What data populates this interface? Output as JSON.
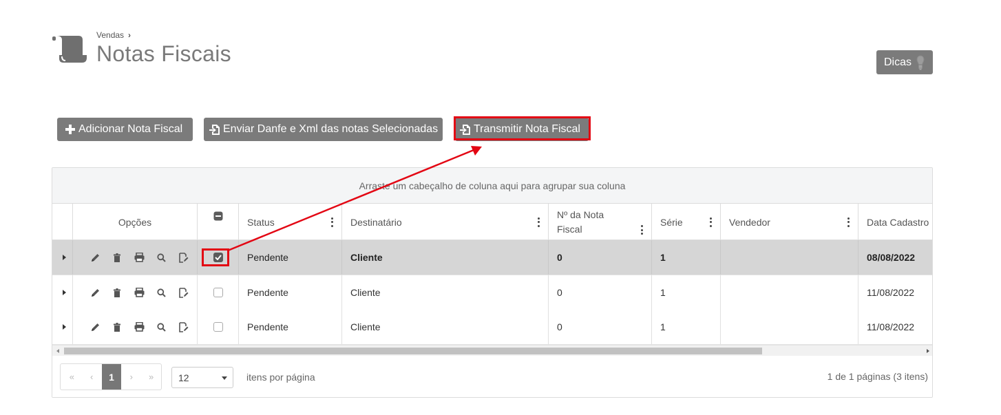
{
  "header": {
    "breadcrumb": "Vendas",
    "breadcrumb_sep": "›",
    "title": "Notas Fiscais",
    "tips_label": "Dicas"
  },
  "toolbar": {
    "add_label": "Adicionar Nota Fiscal",
    "send_label": "Enviar Danfe e Xml das notas Selecionadas",
    "transmit_label": "Transmitir Nota Fiscal"
  },
  "grid": {
    "group_hint": "Arraste um cabeçalho de coluna aqui para agrupar sua coluna",
    "columns": {
      "options": "Opções",
      "status": "Status",
      "recipient": "Destinatário",
      "invoice_number_line1": "Nº da Nota",
      "invoice_number_line2": "Fiscal",
      "series": "Série",
      "seller": "Vendedor",
      "created": "Data Cadastro"
    },
    "rows": [
      {
        "status": "Pendente",
        "recipient": "Cliente",
        "number": "0",
        "series": "1",
        "seller": "",
        "created": "08/08/2022",
        "selected": true
      },
      {
        "status": "Pendente",
        "recipient": "Cliente",
        "number": "0",
        "series": "1",
        "seller": "",
        "created": "11/08/2022",
        "selected": false
      },
      {
        "status": "Pendente",
        "recipient": "Cliente",
        "number": "0",
        "series": "1",
        "seller": "",
        "created": "11/08/2022",
        "selected": false
      }
    ]
  },
  "pagination": {
    "first": "«",
    "prev": "‹",
    "current_page": "1",
    "next": "›",
    "last": "»",
    "page_size": "12",
    "per_page_label": "itens por página",
    "info": "1 de 1 páginas (3 itens)"
  },
  "colors": {
    "button_bg": "#7b7b7b",
    "highlight": "#e30613",
    "selected_row": "#d6d6d6"
  },
  "icons": [
    "scroll-icon",
    "lightbulb-icon",
    "plus-icon",
    "file-export-icon",
    "pencil-icon",
    "trash-icon",
    "print-icon",
    "search-icon",
    "edit-document-icon"
  ]
}
